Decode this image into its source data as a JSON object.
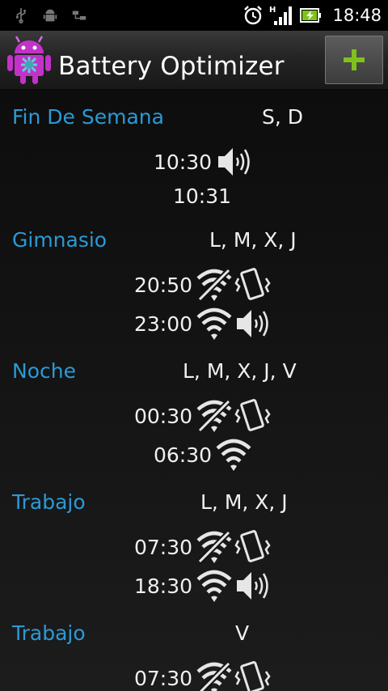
{
  "status_bar": {
    "left_icons": [
      "usb-icon",
      "android-debug-icon",
      "network-transfer-icon"
    ],
    "right_icons": [
      "alarm-clock-icon",
      "signal-h-icon",
      "battery-charging-icon"
    ],
    "network_type": "H",
    "time": "18:48"
  },
  "action_bar": {
    "app_icon": "android-robot-icon",
    "title": "Battery Optimizer",
    "add_button_icon": "plus-icon",
    "accent_color": "#7fc21b"
  },
  "colors": {
    "profile_name": "#2a9ad6",
    "text": "#f0f0f0",
    "background": "#141414"
  },
  "profiles": [
    {
      "name": "Fin De Semana",
      "days": "S, D",
      "schedules": [
        {
          "time": "10:30",
          "icons": [
            "sound-on-icon"
          ]
        },
        {
          "time": "10:31",
          "icons": []
        }
      ]
    },
    {
      "name": "Gimnasio",
      "days": "L, M, X, J",
      "schedules": [
        {
          "time": "20:50",
          "icons": [
            "wifi-off-icon",
            "vibrate-icon"
          ]
        },
        {
          "time": "23:00",
          "icons": [
            "wifi-on-icon",
            "sound-on-icon"
          ]
        }
      ]
    },
    {
      "name": "Noche",
      "days": "L, M, X, J, V",
      "schedules": [
        {
          "time": "00:30",
          "icons": [
            "wifi-off-icon",
            "vibrate-icon"
          ]
        },
        {
          "time": "06:30",
          "icons": [
            "wifi-on-icon"
          ]
        }
      ]
    },
    {
      "name": "Trabajo",
      "days": "L, M, X, J",
      "schedules": [
        {
          "time": "07:30",
          "icons": [
            "wifi-off-icon",
            "vibrate-icon"
          ]
        },
        {
          "time": "18:30",
          "icons": [
            "wifi-on-icon",
            "sound-on-icon"
          ]
        }
      ]
    },
    {
      "name": "Trabajo",
      "days": "V",
      "schedules": [
        {
          "time": "07:30",
          "icons": [
            "wifi-off-icon",
            "vibrate-icon"
          ]
        }
      ]
    }
  ]
}
